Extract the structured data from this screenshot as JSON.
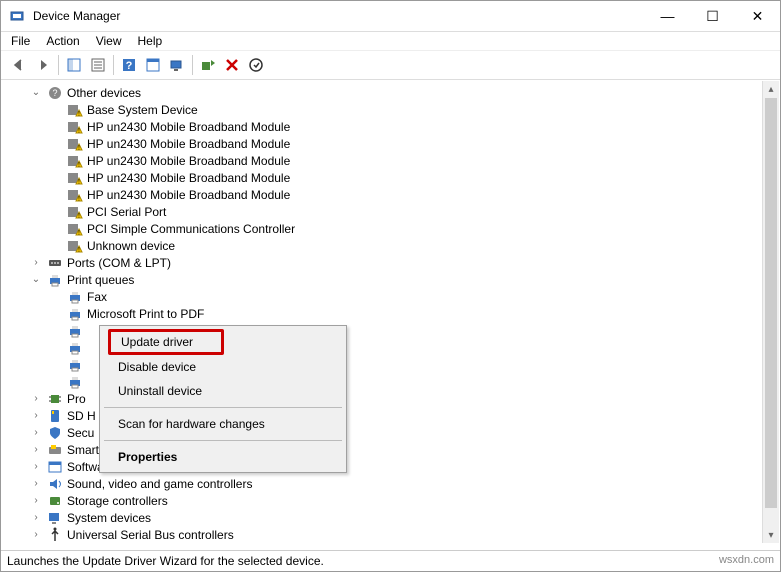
{
  "window": {
    "title": "Device Manager",
    "btn_min": "—",
    "btn_max": "☐",
    "btn_close": "✕"
  },
  "menu": {
    "file": "File",
    "action": "Action",
    "view": "View",
    "help": "Help"
  },
  "tree": {
    "other_devices": "Other devices",
    "base_system": "Base System Device",
    "hp_broadband": "HP un2430 Mobile Broadband Module",
    "pci_serial": "PCI Serial Port",
    "pci_comm": "PCI Simple Communications Controller",
    "unknown": "Unknown device",
    "ports": "Ports (COM & LPT)",
    "print_queues": "Print queues",
    "fax": "Fax",
    "ms_pdf": "Microsoft Print to PDF",
    "processors": "Pro",
    "sd_host": "SD H",
    "security": "Secu",
    "smart_card": "Smart card readers",
    "software": "Software devices",
    "sound": "Sound, video and game controllers",
    "storage": "Storage controllers",
    "system": "System devices",
    "usb": "Universal Serial Bus controllers"
  },
  "context": {
    "update": "Update driver",
    "disable": "Disable device",
    "uninstall": "Uninstall device",
    "scan": "Scan for hardware changes",
    "properties": "Properties"
  },
  "status": {
    "text": "Launches the Update Driver Wizard for the selected device.",
    "watermark": "wsxdn.com"
  }
}
